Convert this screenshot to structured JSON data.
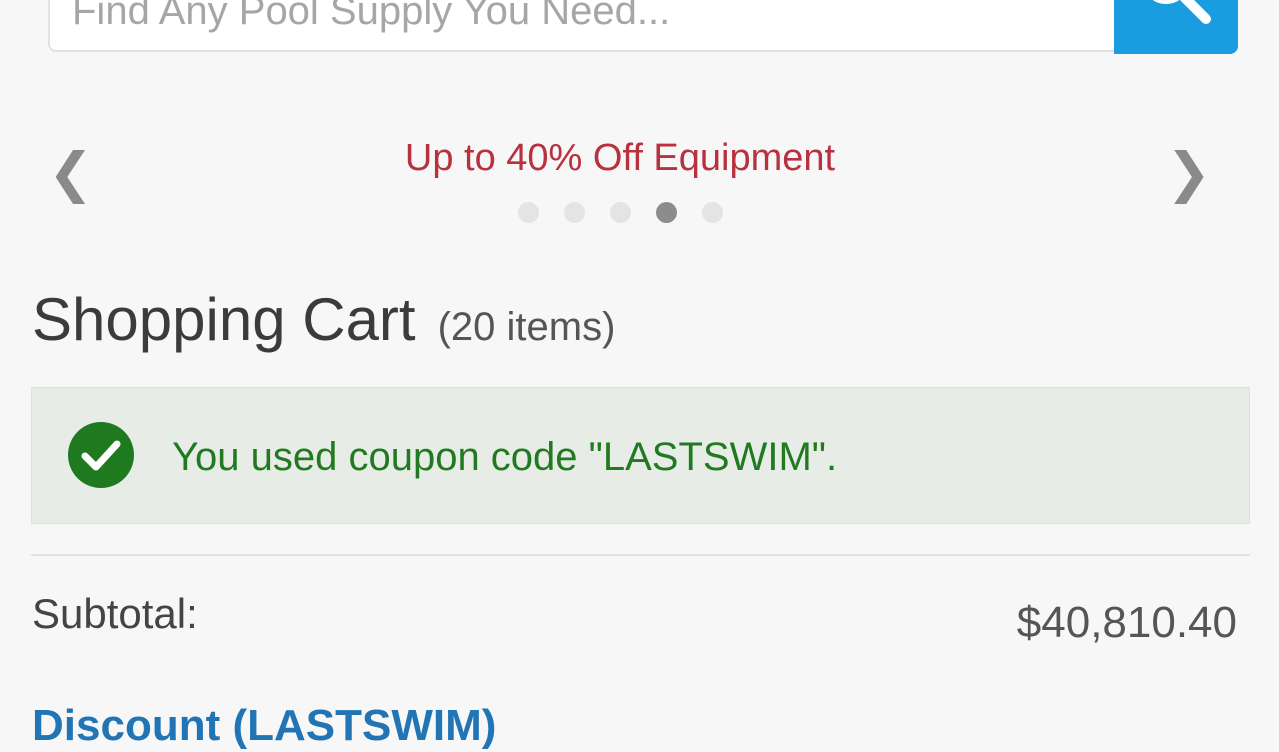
{
  "search": {
    "placeholder": "Find Any Pool Supply You Need..."
  },
  "promo": {
    "text": "Up to 40% Off Equipment",
    "prev": "❮",
    "next": "❯",
    "dot_count": 5,
    "active_dot": 4,
    "color": "#b8313e"
  },
  "cart": {
    "title": "Shopping Cart",
    "count": "(20 items)"
  },
  "alert": {
    "message": "You used coupon code \"LASTSWIM\".",
    "icon": "check-circle-icon",
    "color": "#217a21"
  },
  "summary": {
    "subtotal_label": "Subtotal:",
    "subtotal_value": "$40,810.40",
    "discount_label": "Discount (LASTSWIM)",
    "discount_value": ""
  },
  "colors": {
    "accent": "#1a9ce0",
    "link": "#2275b5"
  }
}
